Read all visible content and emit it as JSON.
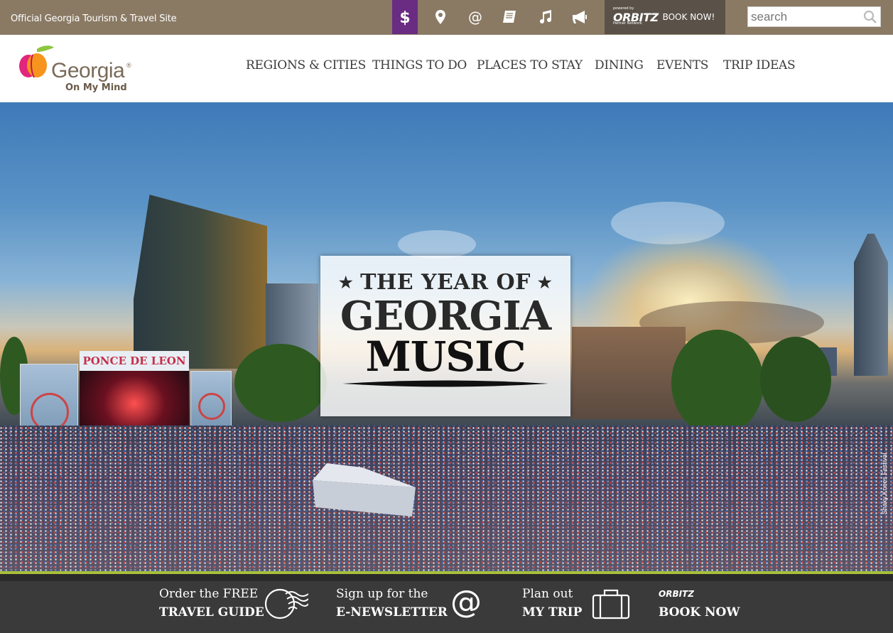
{
  "topbar": {
    "site_label": "Official Georgia Tourism & Travel Site",
    "icons": [
      "dollar-icon",
      "map-pin-icon",
      "at-icon",
      "book-icon",
      "music-note-icon",
      "megaphone-icon"
    ],
    "orbitz": {
      "brand": "ORBITZ",
      "powered": "powered by",
      "network": "Partner Network",
      "cta": "BOOK NOW!"
    },
    "search": {
      "placeholder": "search"
    },
    "colors": {
      "bar": "#8a7a64",
      "active": "#6a2b83"
    }
  },
  "header": {
    "logo": {
      "wordmark": "Georgia",
      "reg": "®",
      "tagline": "On My Mind"
    },
    "nav": [
      "REGIONS & CITIES",
      "THINGS TO DO",
      "PLACES TO STAY",
      "DINING",
      "EVENTS",
      "TRIP IDEAS"
    ]
  },
  "hero": {
    "stage_sign": "PONCE DE LEON",
    "feature": {
      "line1": "THE YEAR OF",
      "star": "★",
      "line2": "GEORGIA",
      "line3": "MUSIC"
    },
    "credit": "Shaky Knees Festival"
  },
  "footer": {
    "ctas": [
      {
        "small": "Order the FREE",
        "big": "TRAVEL GUIDE"
      },
      {
        "small": "Sign up for the",
        "big": "E-NEWSLETTER"
      },
      {
        "small": "Plan out",
        "big": "MY TRIP"
      },
      {
        "small": "ORBITZ",
        "big": "BOOK NOW"
      }
    ],
    "colors": {
      "bar": "#3a3a3a",
      "accent": "#a8c03a"
    }
  }
}
